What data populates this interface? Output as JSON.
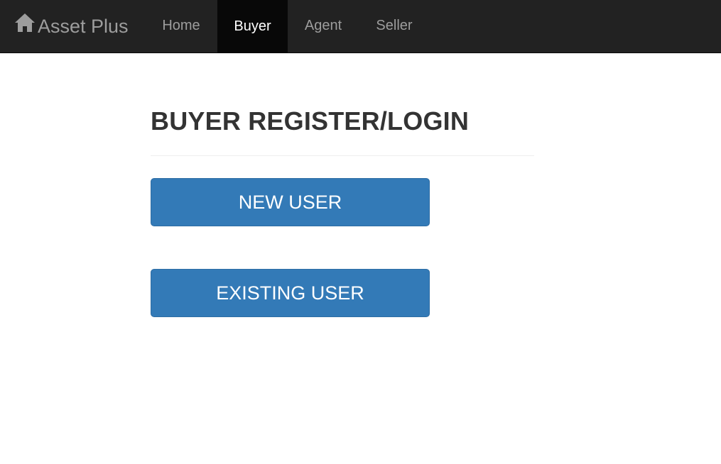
{
  "navbar": {
    "brand": {
      "icon": "home-icon",
      "label": "Asset Plus"
    },
    "items": [
      {
        "label": "Home",
        "active": false
      },
      {
        "label": "Buyer",
        "active": true
      },
      {
        "label": "Agent",
        "active": false
      },
      {
        "label": "Seller",
        "active": false
      }
    ]
  },
  "main": {
    "title": "BUYER REGISTER/LOGIN",
    "new_user_label": "NEW USER",
    "existing_user_label": "EXISTING USER"
  },
  "colors": {
    "navbar_bg": "#222222",
    "navbar_active_bg": "#080808",
    "nav_text": "#9d9d9d",
    "nav_text_active": "#ffffff",
    "primary_button": "#337ab7",
    "title_text": "#333333"
  }
}
